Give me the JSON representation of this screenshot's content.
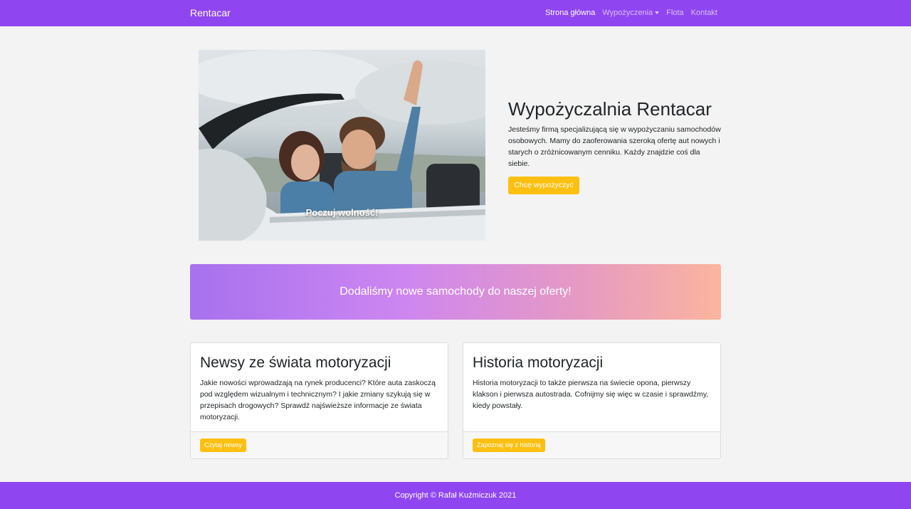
{
  "navbar": {
    "brand": "Rentacar",
    "links": [
      {
        "label": "Strona główna"
      },
      {
        "label": "Wypożyczenia"
      },
      {
        "label": "Flota"
      },
      {
        "label": "Kontakt"
      }
    ],
    "color": "#8f45f0"
  },
  "hero": {
    "caption": "Poczuj wolność!",
    "title": "Wypożyczalnia Rentacar",
    "description": "Jesteśmy firmą specjalizującą się w wypożyczaniu samochodów osobowych. Mamy do zaoferowania szeroką ofertę aut nowych i starych o zróżnicowanym cenniku. Każdy znajdzie coś dla siebie.",
    "button": "Chcę wypożyczyć"
  },
  "banner": {
    "text": "Dodaliśmy nowe samochody do naszej oferty!"
  },
  "cards": [
    {
      "title": "Newsy ze świata motoryzacji",
      "text": "Jakie nowości wprowadzają na rynek producenci? Które auta zaskoczą pod względem wizualnym i technicznym? I jakie zmiany szykują się w przepisach drogowych? Sprawdź najświeższe informacje ze świata motoryzacji.",
      "button": "Czytaj newsy"
    },
    {
      "title": "Historia motoryzacji",
      "text": "Historia motoryzacji to także pierwsza na świecie opona, pierwszy klakson i pierwsza autostrada. Cofnijmy się więc w czasie i sprawdźmy, kiedy powstały.",
      "button": "Zapoznaj się z historią"
    }
  ],
  "footer": {
    "text": "Copyright © Rafał Kuźmiczuk 2021"
  },
  "colors": {
    "accent": "#8f45f0",
    "button": "#fdc011",
    "background": "#f3f3f3"
  }
}
